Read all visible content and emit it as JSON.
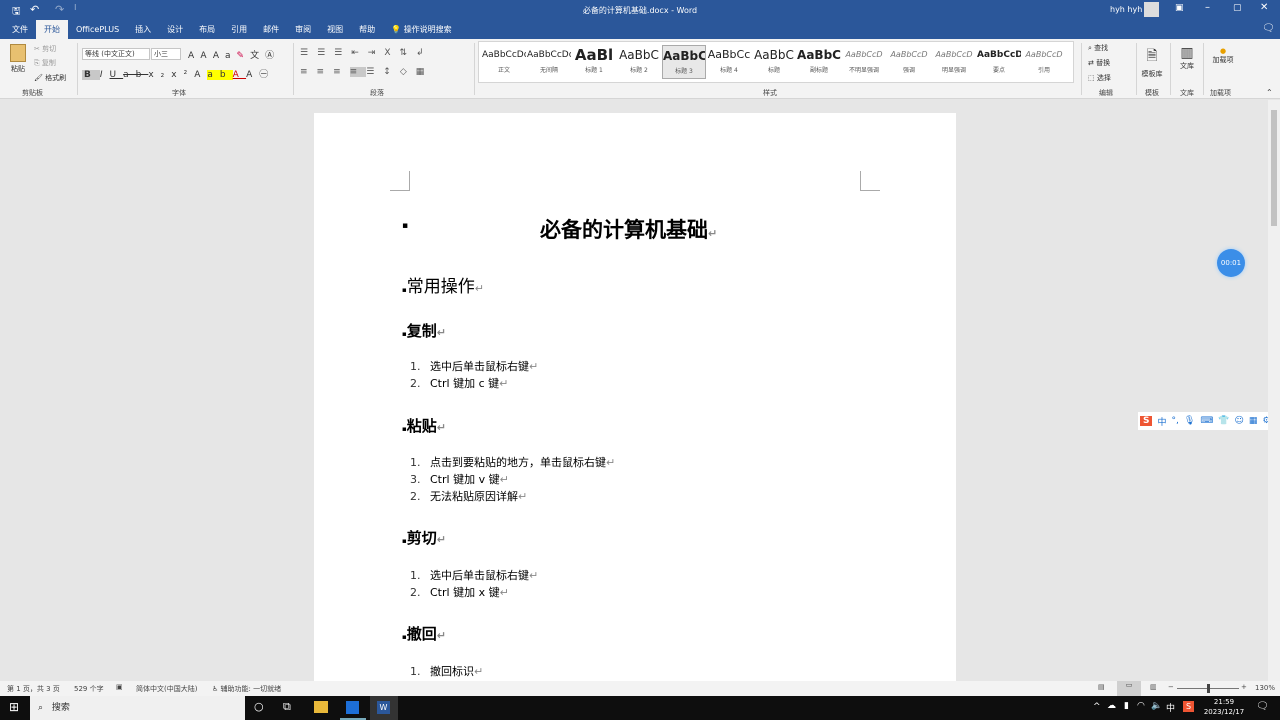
{
  "titlebar": {
    "title": "必备的计算机基础.docx - Word",
    "user": "hyh hyh"
  },
  "tabs": [
    "文件",
    "开始",
    "OfficePLUS",
    "插入",
    "设计",
    "布局",
    "引用",
    "邮件",
    "审阅",
    "视图",
    "帮助"
  ],
  "tell_me": "操作说明搜索",
  "ribbon": {
    "clipboard": {
      "paste": "粘贴",
      "cut": "剪切",
      "copy": "复制",
      "format_painter": "格式刷",
      "label": "剪贴板"
    },
    "font": {
      "name": "等线 (中文正文)",
      "size": "小三",
      "label": "字体"
    },
    "paragraph": {
      "label": "段落"
    },
    "styles": {
      "label": "样式",
      "items": [
        {
          "sample": "AaBbCcDc",
          "name": "正文"
        },
        {
          "sample": "AaBbCcDc",
          "name": "无间隔"
        },
        {
          "sample": "AaBl",
          "name": "标题 1"
        },
        {
          "sample": "AaBbC",
          "name": "标题 2"
        },
        {
          "sample": "AaBbC",
          "name": "标题 3"
        },
        {
          "sample": "AaBbCc",
          "name": "标题 4"
        },
        {
          "sample": "AaBbC",
          "name": "标题"
        },
        {
          "sample": "AaBbC",
          "name": "副标题"
        },
        {
          "sample": "AaBbCcD",
          "name": "不明显强调"
        },
        {
          "sample": "AaBbCcD",
          "name": "强调"
        },
        {
          "sample": "AaBbCcD",
          "name": "明显强调"
        },
        {
          "sample": "AaBbCcD",
          "name": "要点"
        },
        {
          "sample": "AaBbCcD",
          "name": "引用"
        }
      ]
    },
    "editing": {
      "find": "查找",
      "replace": "替换",
      "select": "选择",
      "label": "编辑"
    },
    "template": {
      "btn": "模板库",
      "label": "模板"
    },
    "library": {
      "btn": "文库",
      "label": "文库"
    },
    "addins": {
      "btn": "加载项",
      "label": "加载项"
    }
  },
  "document": {
    "title": "必备的计算机基础",
    "h2": "常用操作",
    "sections": [
      {
        "heading": "复制",
        "items": [
          {
            "num": "1.",
            "text": "选中后单击鼠标右键"
          },
          {
            "num": "2.",
            "text": "Ctrl 键加 c 键"
          }
        ]
      },
      {
        "heading": "粘贴",
        "items": [
          {
            "num": "1.",
            "text": "点击到要粘贴的地方，单击鼠标右键"
          },
          {
            "num": "3.",
            "text": "Ctrl 键加 v 键"
          },
          {
            "num": "2.",
            "text": "无法粘贴原因详解"
          }
        ]
      },
      {
        "heading": "剪切",
        "items": [
          {
            "num": "1.",
            "text": "选中后单击鼠标右键"
          },
          {
            "num": "2.",
            "text": "Ctrl 键加 x 键"
          }
        ]
      },
      {
        "heading": "撤回",
        "items": [
          {
            "num": "1.",
            "text": "撤回标识"
          }
        ]
      }
    ]
  },
  "timer": "00:01",
  "ime": {
    "lang": "中"
  },
  "statusbar": {
    "page": "第 1 页，共 3 页",
    "words": "529 个字",
    "language": "简体中文(中国大陆)",
    "accessibility": "辅助功能: 一切就绪",
    "zoom": "130%"
  },
  "taskbar": {
    "search": "搜索",
    "time": "21:59",
    "date": "2023/12/17",
    "ime": "中"
  },
  "colors": {
    "word_blue": "#2b579a",
    "taskbar": "#0e0e0e"
  }
}
